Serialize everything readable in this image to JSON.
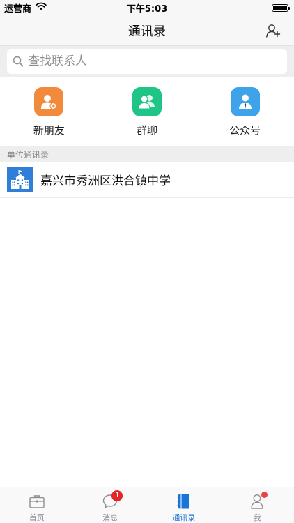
{
  "status_bar": {
    "carrier": "运营商",
    "time": "下午5:03"
  },
  "nav": {
    "title": "通讯录",
    "add_contact_icon": "add-contact-icon"
  },
  "search": {
    "placeholder": "查找联系人",
    "value": ""
  },
  "shortcuts": [
    {
      "label": "新朋友",
      "icon": "new-friend-icon",
      "color": "#f28a3c"
    },
    {
      "label": "群聊",
      "icon": "group-chat-icon",
      "color": "#1fc487"
    },
    {
      "label": "公众号",
      "icon": "official-account-icon",
      "color": "#3fa3ec"
    }
  ],
  "section": {
    "title": "单位通讯录"
  },
  "org_list": [
    {
      "name": "嘉兴市秀洲区洪合镇中学",
      "icon": "school-building-icon",
      "color": "#2f7fd8"
    }
  ],
  "tab_bar": {
    "tabs": [
      {
        "label": "首页",
        "icon": "briefcase-icon",
        "active": false
      },
      {
        "label": "消息",
        "icon": "chat-bubble-icon",
        "badge": "1",
        "active": false
      },
      {
        "label": "通讯录",
        "icon": "address-book-icon",
        "active": true
      },
      {
        "label": "我",
        "icon": "person-icon",
        "dot": true,
        "active": false
      }
    ],
    "active_color": "#1a73d9",
    "inactive_color": "#8e8e93",
    "badge_color": "#e62424"
  }
}
